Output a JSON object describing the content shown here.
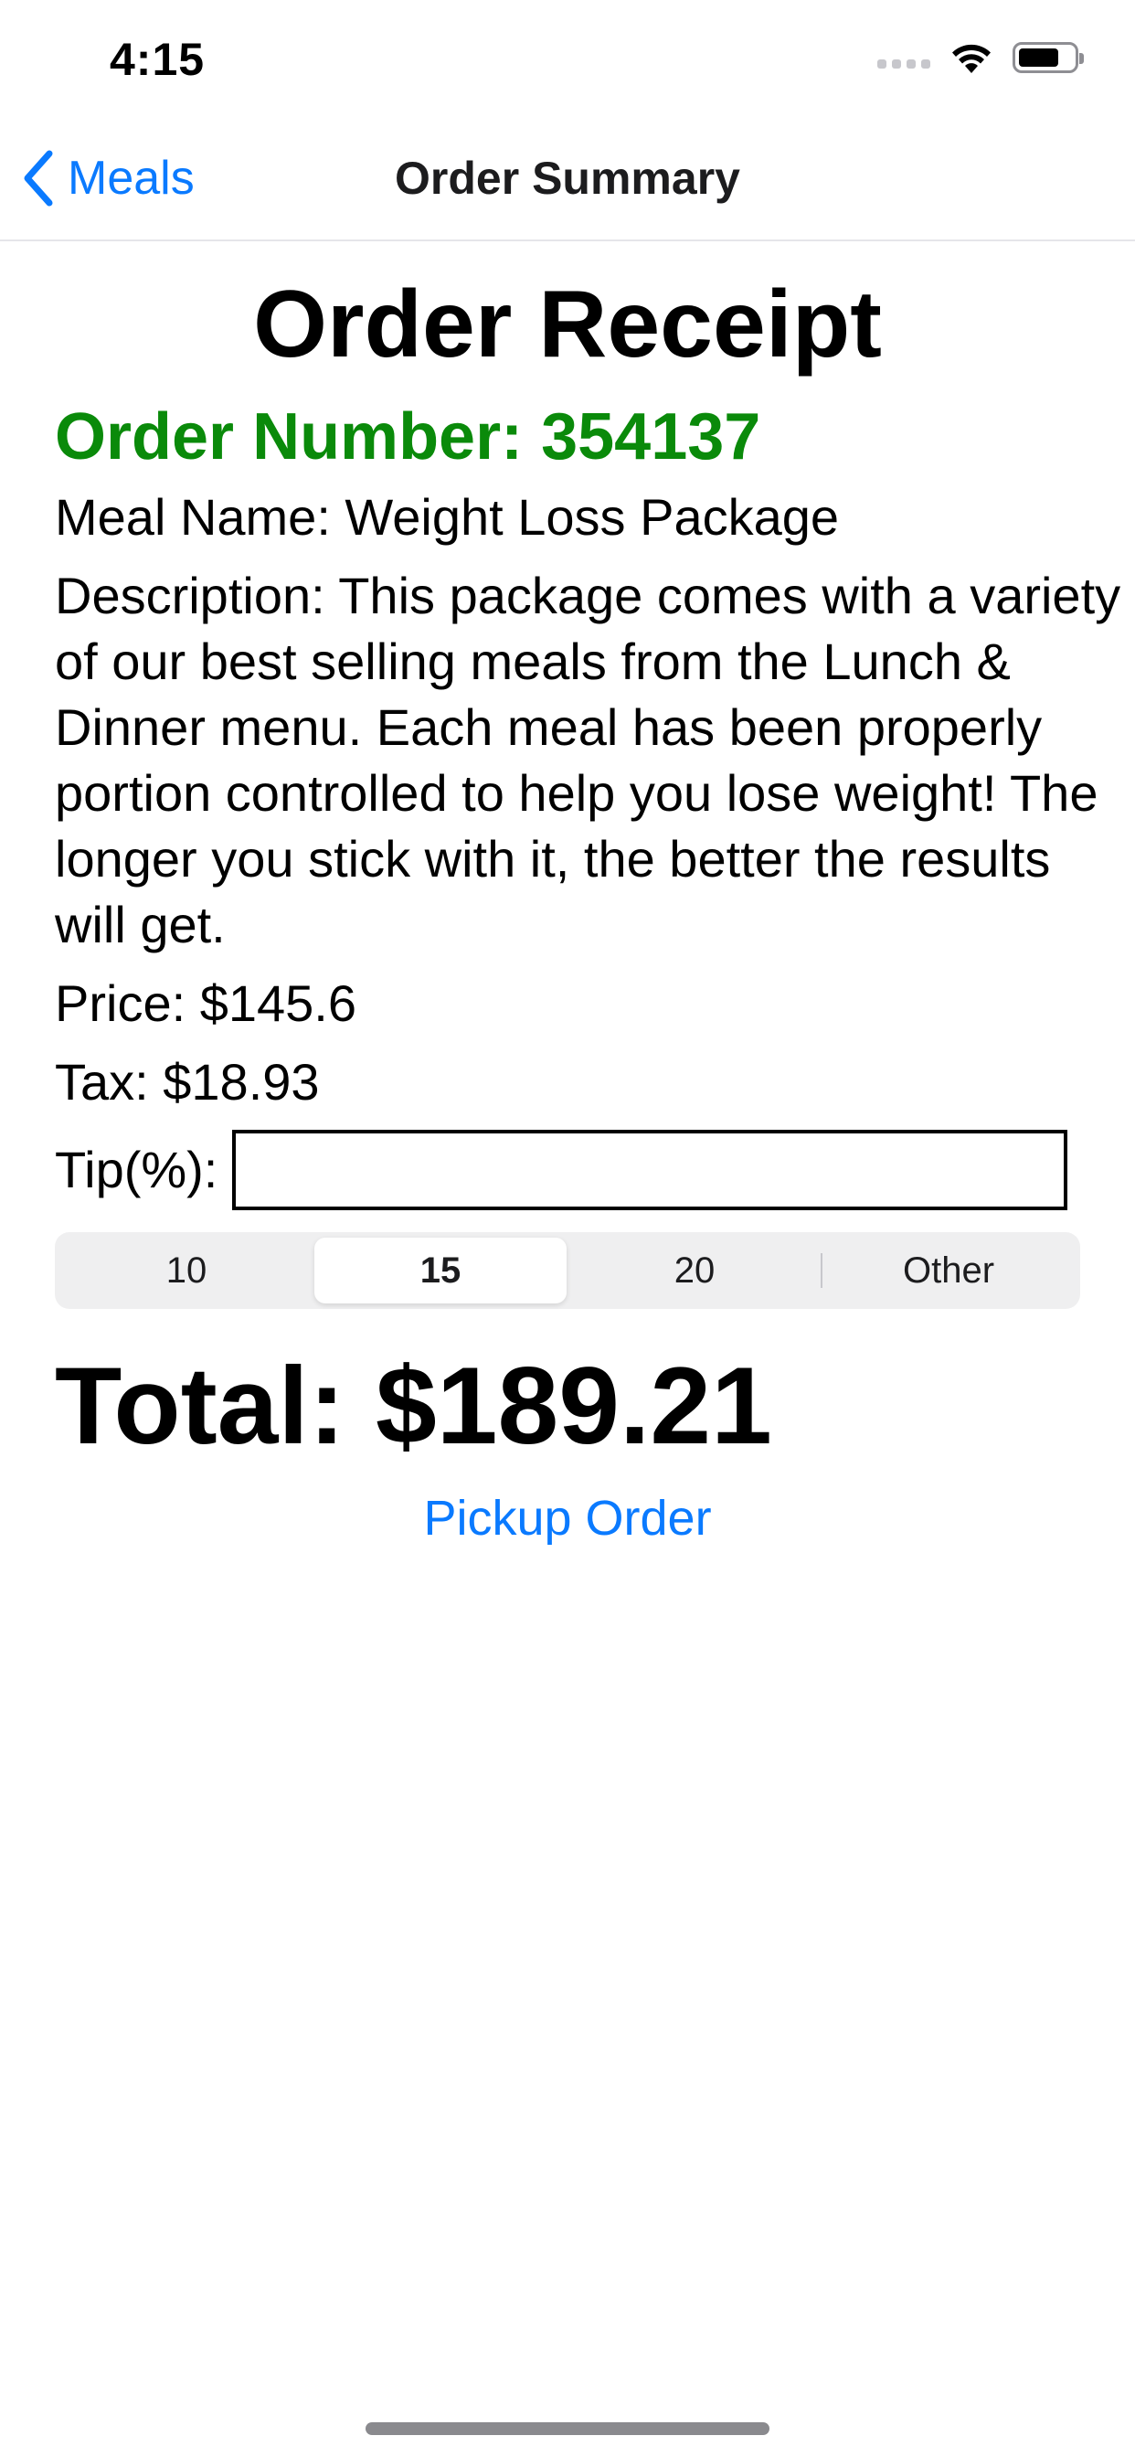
{
  "status_bar": {
    "time": "4:15",
    "icons": [
      "cellular-dots-icon",
      "wifi-icon",
      "battery-icon"
    ]
  },
  "nav": {
    "back_label": "Meals",
    "title": "Order Summary",
    "accent_color": "#0a7aff"
  },
  "receipt": {
    "title": "Order Receipt",
    "order_number": "Order Number: 354137",
    "order_number_color": "#0a8a0a",
    "meal_name": "Meal Name: Weight Loss Package",
    "description": "Description: This package comes with a variety of our best selling meals from the Lunch & Dinner menu. Each meal has been properly portion controlled to help you lose weight! The longer you stick with it, the better the results will get.",
    "price": "Price: $145.6",
    "tax": "Tax: $18.93",
    "tip_label": "Tip(%):",
    "tip_value": "",
    "tip_options": [
      "10",
      "15",
      "20",
      "Other"
    ],
    "tip_selected": "15",
    "total": "Total: $189.21",
    "pickup_label": "Pickup Order"
  }
}
